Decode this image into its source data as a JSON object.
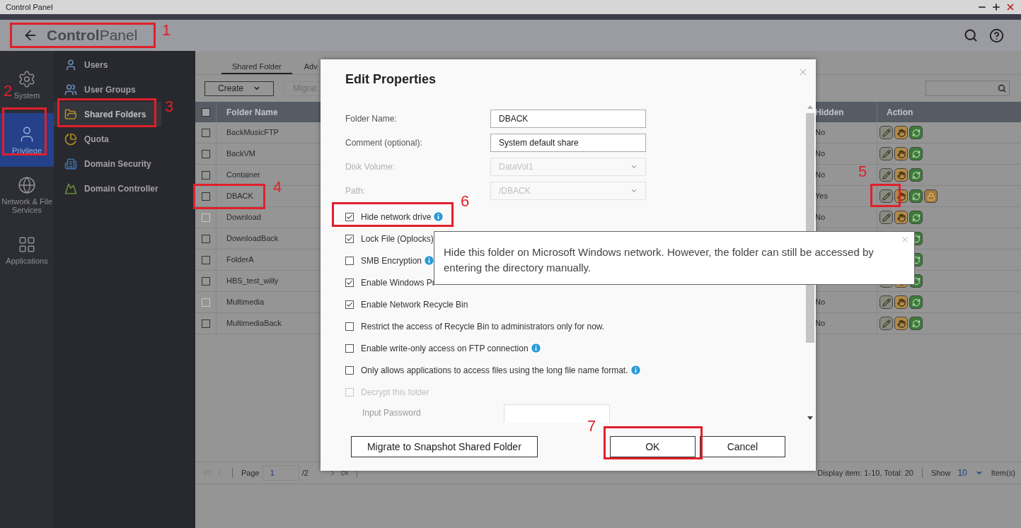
{
  "title_bar": {
    "title": "Control Panel"
  },
  "header": {
    "title": "**Control**Panel"
  },
  "nav": [
    {
      "label": "System",
      "selected": false
    },
    {
      "label": "Privilege",
      "selected": true
    },
    {
      "label": "Network & File Services",
      "selected": false
    },
    {
      "label": "Applications",
      "selected": false
    }
  ],
  "submenu": [
    {
      "label": "Users",
      "selected": false
    },
    {
      "label": "User Groups",
      "selected": false
    },
    {
      "label": "Shared Folders",
      "selected": true
    },
    {
      "label": "Quota",
      "selected": false
    },
    {
      "label": "Domain Security",
      "selected": false
    },
    {
      "label": "Domain Controller",
      "selected": false
    }
  ],
  "tabs": [
    {
      "label": "Shared Folder",
      "selected": true
    },
    {
      "label": "Adv",
      "selected": false
    }
  ],
  "toolbar": {
    "create": "Create",
    "migrate": "Migrat"
  },
  "table": {
    "select_all_checked": false,
    "columns": [
      "Folder Name",
      "Hidden",
      "Action"
    ],
    "rows": [
      {
        "name": "BackMusicFTP",
        "hidden": "No",
        "disabled": false,
        "locked": false
      },
      {
        "name": "BackVM",
        "hidden": "No",
        "disabled": false,
        "locked": false
      },
      {
        "name": "Container",
        "hidden": "No",
        "disabled": false,
        "locked": false
      },
      {
        "name": "DBACK",
        "hidden": "Yes",
        "disabled": false,
        "locked": true
      },
      {
        "name": "Download",
        "hidden": "No",
        "disabled": true,
        "locked": false
      },
      {
        "name": "DownloadBack",
        "disabled": false,
        "locked": false
      },
      {
        "name": "FolderA",
        "disabled": false,
        "locked": false
      },
      {
        "name": "HBS_test_willy",
        "disabled": false,
        "locked": false
      },
      {
        "name": "Multimedia",
        "hidden": "No",
        "disabled": true,
        "locked": false
      },
      {
        "name": "MultimediaBack",
        "hidden": "No",
        "disabled": false,
        "locked": false
      }
    ]
  },
  "pagination": {
    "page_label": "Page",
    "page": "1",
    "total_pages": "/2",
    "display": "Display item: 1-10, Total: 20",
    "show_label": "Show",
    "show_value": "10",
    "items_label": "Item(s)"
  },
  "dialog": {
    "title": "Edit Properties",
    "fields": [
      {
        "label": "Folder Name:",
        "value": "DBACK",
        "disabled": false,
        "kind": "text"
      },
      {
        "label": "Comment (optional):",
        "value": "System default share",
        "disabled": false,
        "kind": "text"
      },
      {
        "label": "Disk Volume:",
        "value": "DataVol1",
        "disabled": true,
        "kind": "select"
      },
      {
        "label": "Path:",
        "value": "/DBACK",
        "disabled": true,
        "kind": "select"
      }
    ],
    "options": [
      {
        "label": "Hide network drive",
        "checked": true,
        "disabled": false,
        "info": true
      },
      {
        "label": "Lock File (Oplocks)",
        "checked": true,
        "disabled": false,
        "info": false
      },
      {
        "label": "SMB Encryption",
        "checked": false,
        "disabled": false,
        "info": true
      },
      {
        "label": "Enable Windows Pr",
        "checked": true,
        "disabled": false,
        "info": false
      },
      {
        "label": "Enable Network Recycle Bin",
        "checked": true,
        "disabled": false,
        "info": false
      },
      {
        "label": "Restrict the access of Recycle Bin to administrators only for now.",
        "checked": false,
        "disabled": false,
        "info": false
      },
      {
        "label": "Enable write-only access on FTP connection",
        "checked": false,
        "disabled": false,
        "info": true
      },
      {
        "label": "Only allows applications to access files using the long file name format.",
        "checked": false,
        "disabled": false,
        "info": true
      },
      {
        "label": "Decrypt this folder",
        "checked": false,
        "disabled": true,
        "info": false
      }
    ],
    "password": {
      "label": "Input Password"
    },
    "buttons": [
      {
        "label": "Migrate to Snapshot Shared Folder"
      },
      {
        "label": "OK"
      },
      {
        "label": "Cancel"
      }
    ]
  },
  "tooltip": {
    "text": "Hide this folder on Microsoft Windows network. However, the folder can still be accessed by entering the directory manually."
  },
  "annotations": [
    {
      "label": "1"
    },
    {
      "label": "2"
    },
    {
      "label": "3"
    },
    {
      "label": "4"
    },
    {
      "label": "5"
    },
    {
      "label": "6"
    },
    {
      "label": "7"
    }
  ]
}
